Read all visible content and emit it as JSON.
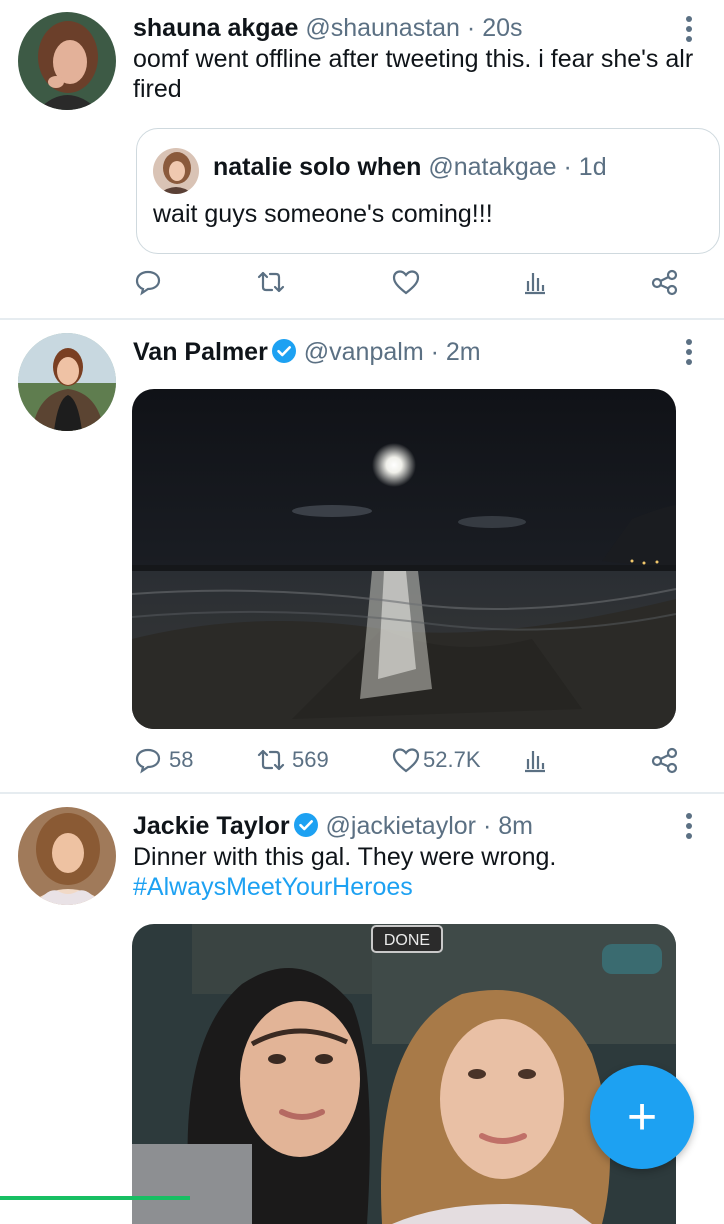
{
  "tweets": [
    {
      "name": "shauna akgae",
      "handle": "@shaunastan",
      "time": "· 20s",
      "text": "oomf went offline after tweeting this. i fear she's alr fired",
      "quote": {
        "name": "natalie solo when",
        "handle": "@natakgae",
        "time": "· 1d",
        "text": "wait guys someone's coming!!!"
      },
      "actions": {
        "reply": "",
        "retweet": "",
        "like": ""
      }
    },
    {
      "name": "Van Palmer",
      "handle": "@vanpalm",
      "time": "· 2m",
      "verified": true,
      "media": "night-beach-moon-photo",
      "actions": {
        "reply": "58",
        "retweet": "569",
        "like": "52.7K"
      }
    },
    {
      "name": "Jackie Taylor",
      "handle": "@jackietaylor",
      "time": "· 8m",
      "verified": true,
      "text": "Dinner with this gal. They were wrong.",
      "hashtag": "#AlwaysMeetYourHeroes",
      "media": "two-women-selfie-photo",
      "sign_text": "DONE"
    }
  ],
  "colors": {
    "accent": "#1da1f2",
    "text": "#0f1419",
    "secondary": "#5b7083",
    "divider": "#e6ecf0"
  },
  "fab": {
    "icon": "plus-icon",
    "label": "+"
  }
}
